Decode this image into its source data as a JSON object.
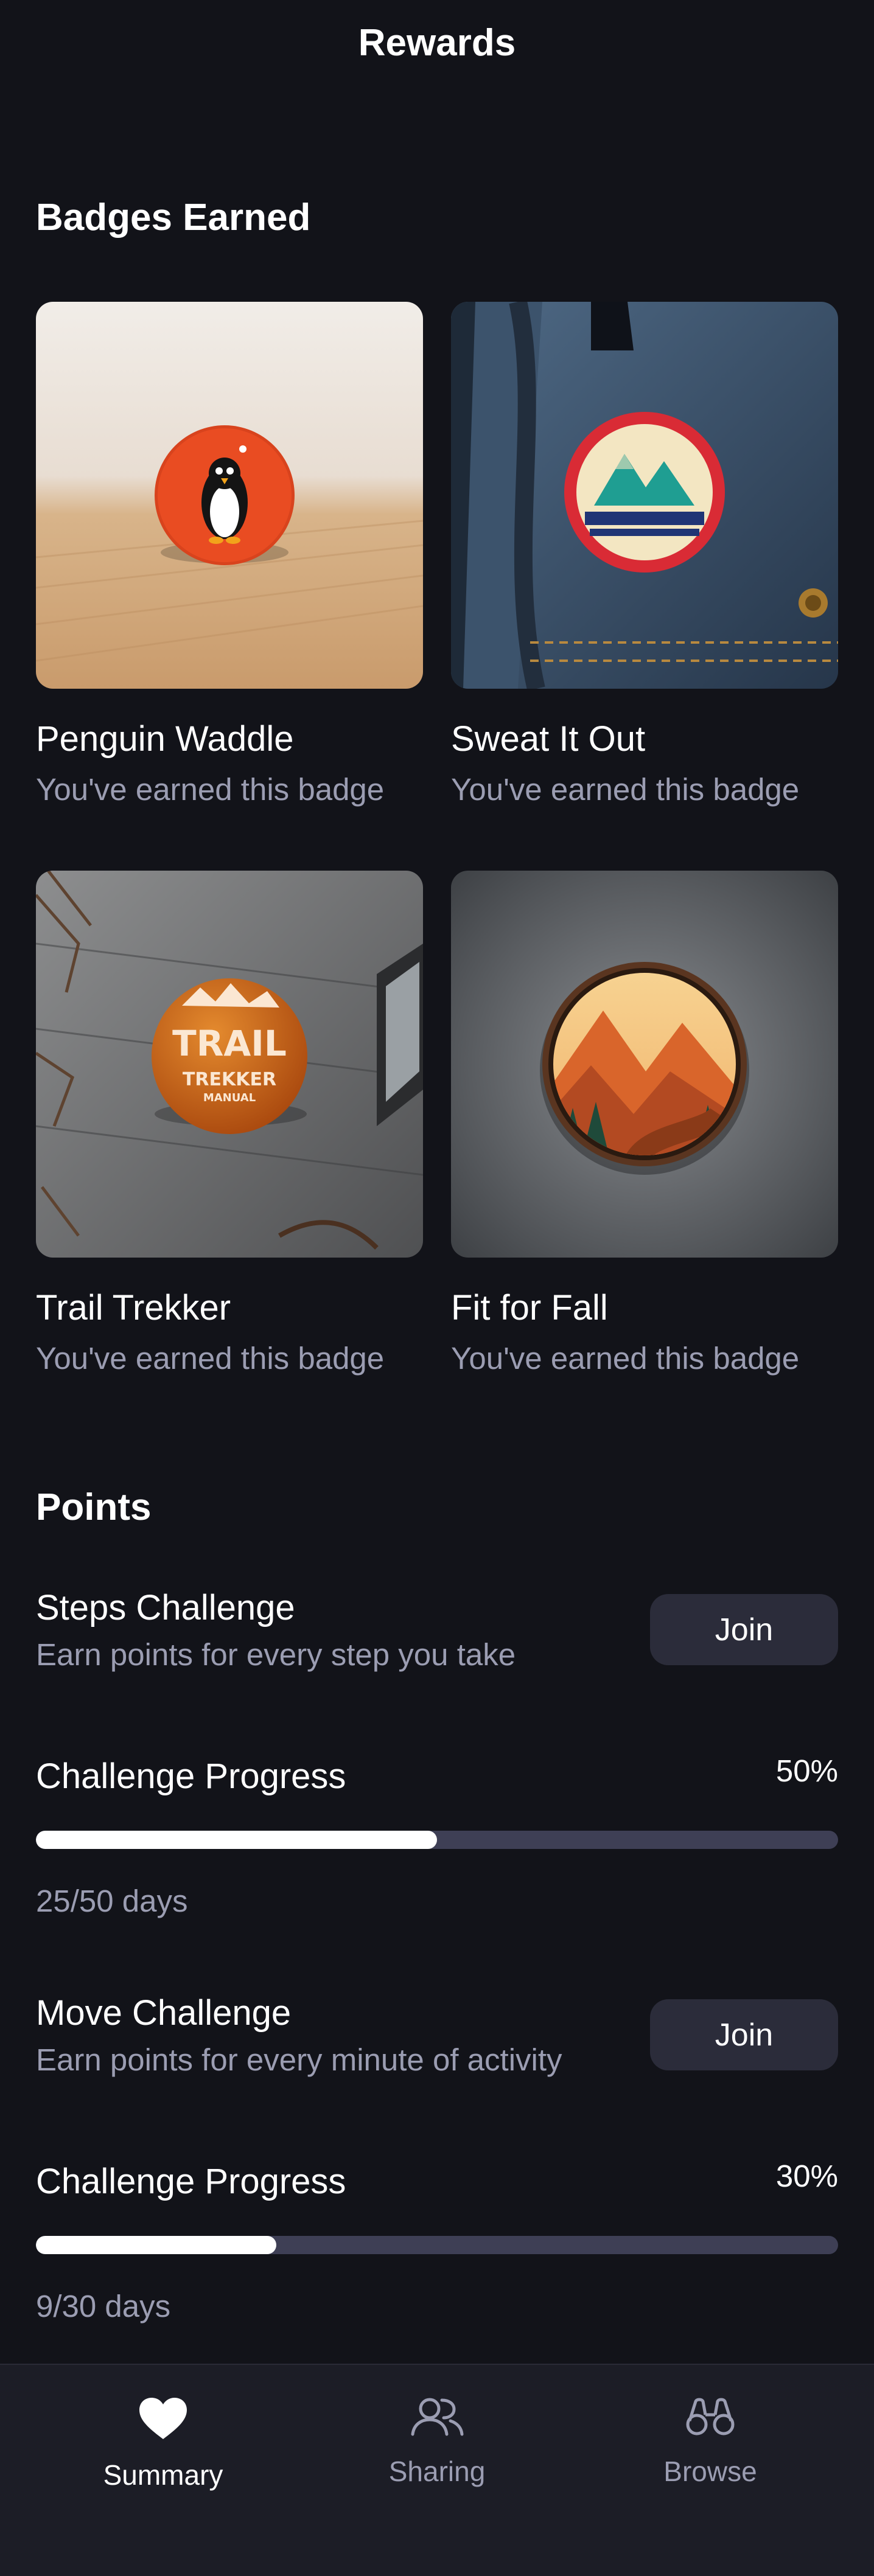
{
  "header": {
    "title": "Rewards"
  },
  "badges_section": {
    "title": "Badges Earned",
    "items": [
      {
        "name": "Penguin Waddle",
        "status": "You've earned this badge",
        "image": "penguin-badge-photo"
      },
      {
        "name": "Sweat It Out",
        "status": "You've earned this badge",
        "image": "mountain-patch-photo"
      },
      {
        "name": "Trail Trekker",
        "status": "You've earned this badge",
        "image": "trail-trekker-pin-photo"
      },
      {
        "name": "Fit for Fall",
        "status": "You've earned this badge",
        "image": "autumn-mountain-badge-photo"
      }
    ],
    "trail_pin_text": {
      "line1": "TRAIL",
      "line2": "TREKKER",
      "line3": "MANUAL"
    }
  },
  "points_section": {
    "title": "Points",
    "challenges": [
      {
        "title": "Steps Challenge",
        "description": "Earn points for every step you take",
        "button": "Join",
        "progress_label": "Challenge Progress",
        "percent_text": "50%",
        "progress_fraction": 0.5,
        "days_text": "25/50 days"
      },
      {
        "title": "Move Challenge",
        "description": "Earn points for every minute of activity",
        "button": "Join",
        "progress_label": "Challenge Progress",
        "percent_text": "30%",
        "progress_fraction": 0.3,
        "days_text": "9/30 days"
      }
    ]
  },
  "tabbar": {
    "tabs": [
      {
        "label": "Summary",
        "icon": "heart-icon",
        "active": true
      },
      {
        "label": "Sharing",
        "icon": "people-icon",
        "active": false
      },
      {
        "label": "Browse",
        "icon": "binoculars-icon",
        "active": false
      }
    ]
  },
  "colors": {
    "background": "#121319",
    "tabbar_background": "#1c1d26",
    "secondary_text": "#9b9db2",
    "button_background": "#2b2c3a",
    "progress_track": "#3e3f55",
    "progress_fill": "#ffffff"
  }
}
